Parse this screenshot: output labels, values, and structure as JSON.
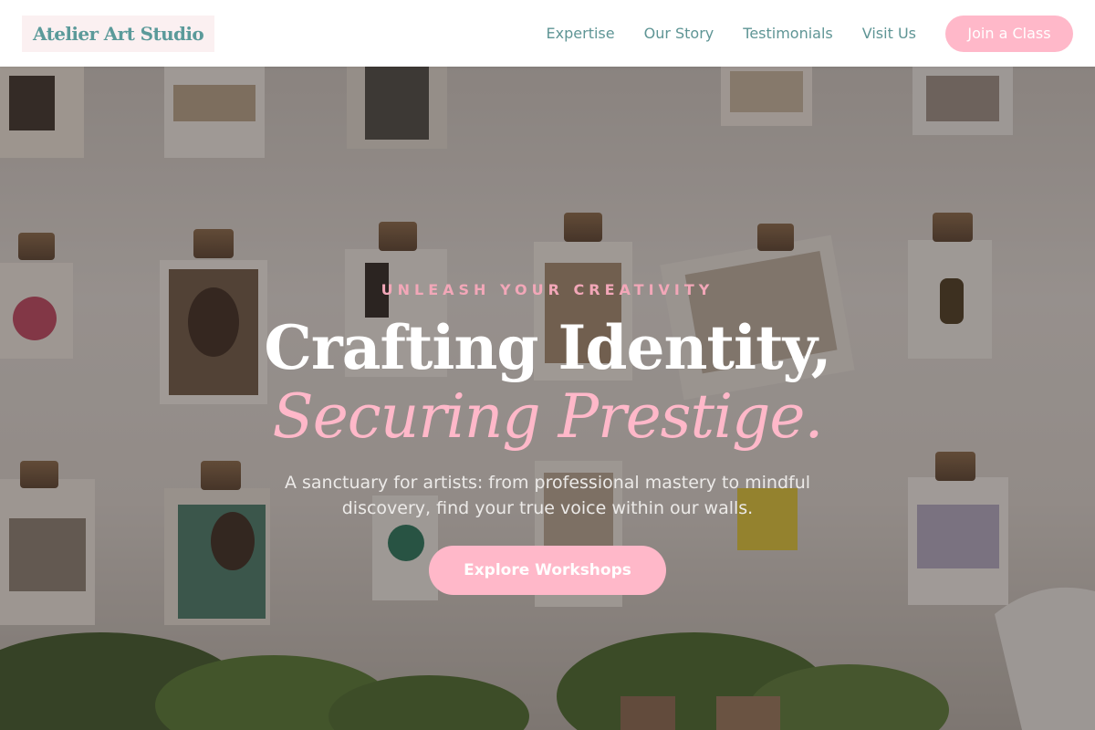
{
  "brand": {
    "name": "Atelier Art Studio"
  },
  "nav": {
    "links": [
      "Expertise",
      "Our Story",
      "Testimonials",
      "Visit Us"
    ],
    "cta_label": "Join a Class"
  },
  "hero": {
    "eyebrow": "UNLEASH YOUR CREATIVITY",
    "headline_line1": "Crafting Identity,",
    "headline_line2": "Securing Prestige.",
    "subtitle": "A sanctuary for artists: from professional mastery to mindful discovery, find your true voice within our walls.",
    "cta_label": "Explore Workshops",
    "background_image": "studio wall of clipboards with magazine prints and potted plants"
  },
  "colors": {
    "brand_teal": "#5b9a9a",
    "accent_pink": "#ffb8c9",
    "eyebrow_pink": "#f2a7b8",
    "logo_bg": "#fbf0f1"
  }
}
